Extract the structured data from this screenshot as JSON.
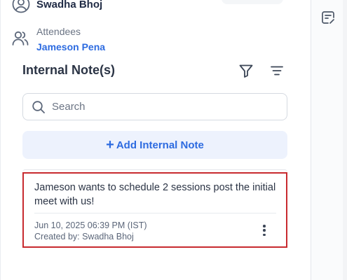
{
  "organizer": {
    "name": "Swadha Bhoj"
  },
  "attendees": {
    "label": "Attendees",
    "name": "Jameson Pena"
  },
  "internal_notes": {
    "title": "Internal Note(s)",
    "search": {
      "placeholder": "Search",
      "value": ""
    },
    "add_button": {
      "plus": "+",
      "label": "Add Internal Note"
    },
    "notes": [
      {
        "text": "Jameson wants to schedule 2 sessions post the initial meet with us!",
        "timestamp": "Jun 10, 2025 06:39 PM (IST)",
        "created_by": "Created by: Swadha Bhoj"
      }
    ]
  },
  "icons": {
    "organizer": "user-circle-icon",
    "attendees": "users-icon",
    "filter": "filter-icon",
    "sort": "sort-lines-icon",
    "search": "search-icon",
    "more": "more-vertical-icon",
    "rail": "note-icon"
  },
  "colors": {
    "accent": "#2d6be0",
    "highlight_border": "#c82a2f",
    "add_button_bg": "#edf2fd"
  }
}
